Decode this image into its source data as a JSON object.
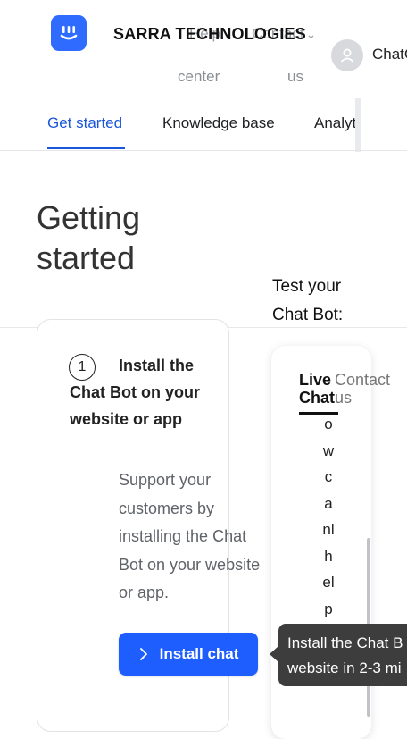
{
  "header": {
    "brand": "SARRA TECHNOLOGIES",
    "help_line1": "Help",
    "help_line2": "center",
    "contact_line1": "Contact",
    "contact_line2": "us",
    "user_label": "ChatG"
  },
  "tabs": [
    {
      "label": "Get started",
      "active": true
    },
    {
      "label": "Knowledge base",
      "active": false
    },
    {
      "label": "Analyt",
      "active": false
    }
  ],
  "page_title": "Getting started",
  "test_label": "Test your Chat Bot:",
  "step": {
    "number": "1",
    "title": "Install the Chat Bot on your website or app",
    "description": "Support your customers by installing the Chat Bot on your website or app.",
    "button_label": "Install chat"
  },
  "widget": {
    "tab_live": "Live Chat",
    "tab_contact": "Contact us",
    "message": "owcanlhelpyo"
  },
  "tooltip": {
    "line1": "Install the Chat B",
    "line2": "website in 2-3 mi"
  },
  "colors": {
    "accent": "#1a56db",
    "button": "#1e5eff",
    "logo": "#2f6bff",
    "tooltip_bg": "#3d3d3d"
  }
}
